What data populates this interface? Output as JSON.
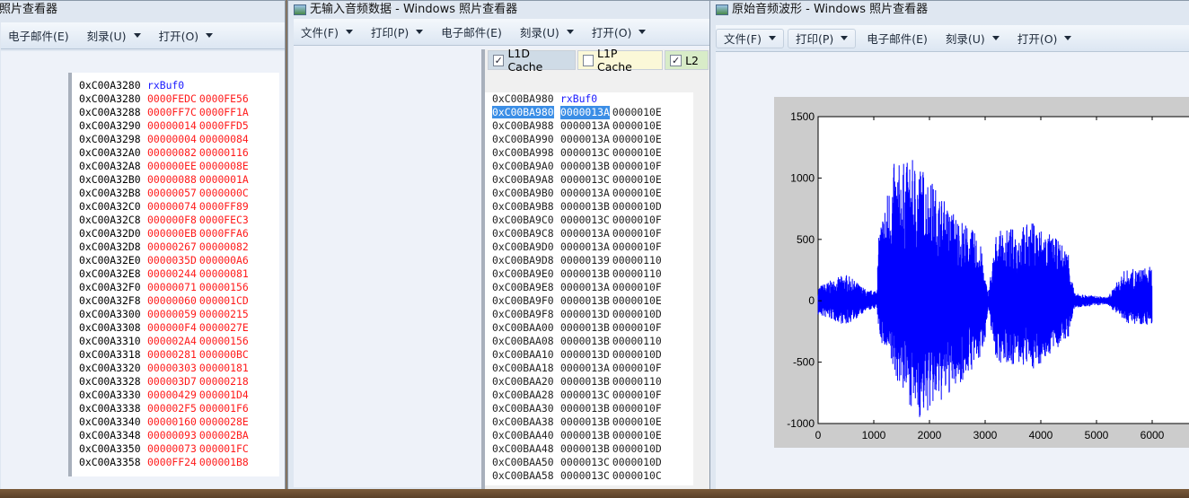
{
  "left_window": {
    "title": "照片查看器",
    "menus": [
      {
        "label": "电子邮件(E)",
        "caret": false
      },
      {
        "label": "刻录(U)",
        "caret": true
      },
      {
        "label": "打开(O)",
        "caret": true
      }
    ],
    "dump": {
      "header": [
        "0xC00A3280",
        "rxBuf0"
      ],
      "rows": [
        [
          "0xC00A3280",
          "0000FEDC",
          "0000FE56"
        ],
        [
          "0xC00A3288",
          "0000FF7C",
          "0000FF1A"
        ],
        [
          "0xC00A3290",
          "00000014",
          "0000FFD5"
        ],
        [
          "0xC00A3298",
          "00000004",
          "00000084"
        ],
        [
          "0xC00A32A0",
          "00000082",
          "00000116"
        ],
        [
          "0xC00A32A8",
          "000000EE",
          "0000008E"
        ],
        [
          "0xC00A32B0",
          "00000088",
          "0000001A"
        ],
        [
          "0xC00A32B8",
          "00000057",
          "0000000C"
        ],
        [
          "0xC00A32C0",
          "00000074",
          "0000FF89"
        ],
        [
          "0xC00A32C8",
          "000000F8",
          "0000FEC3"
        ],
        [
          "0xC00A32D0",
          "000000EB",
          "0000FFA6"
        ],
        [
          "0xC00A32D8",
          "00000267",
          "00000082"
        ],
        [
          "0xC00A32E0",
          "0000035D",
          "000000A6"
        ],
        [
          "0xC00A32E8",
          "00000244",
          "00000081"
        ],
        [
          "0xC00A32F0",
          "00000071",
          "00000156"
        ],
        [
          "0xC00A32F8",
          "00000060",
          "000001CD"
        ],
        [
          "0xC00A3300",
          "00000059",
          "00000215"
        ],
        [
          "0xC00A3308",
          "000000F4",
          "0000027E"
        ],
        [
          "0xC00A3310",
          "000002A4",
          "00000156"
        ],
        [
          "0xC00A3318",
          "00000281",
          "000000BC"
        ],
        [
          "0xC00A3320",
          "00000303",
          "00000181"
        ],
        [
          "0xC00A3328",
          "000003D7",
          "00000218"
        ],
        [
          "0xC00A3330",
          "00000429",
          "000001D4"
        ],
        [
          "0xC00A3338",
          "000002F5",
          "000001F6"
        ],
        [
          "0xC00A3340",
          "00000160",
          "0000028E"
        ],
        [
          "0xC00A3348",
          "00000093",
          "000002BA"
        ],
        [
          "0xC00A3350",
          "00000073",
          "000001FC"
        ],
        [
          "0xC00A3358",
          "0000FF24",
          "000001B8"
        ]
      ]
    }
  },
  "middle_window": {
    "title": "无输入音频数据 - Windows 照片查看器",
    "menus": [
      {
        "label": "文件(F)",
        "caret": true
      },
      {
        "label": "打印(P)",
        "caret": true
      },
      {
        "label": "电子邮件(E)",
        "caret": false
      },
      {
        "label": "刻录(U)",
        "caret": true
      },
      {
        "label": "打开(O)",
        "caret": true
      }
    ],
    "tabs": [
      {
        "label": "L1D Cache",
        "checked": true,
        "color": "#cfdbe6"
      },
      {
        "label": "L1P Cache",
        "checked": false,
        "color": "#fbf8d8"
      },
      {
        "label": "L2",
        "checked": true,
        "color": "#d8ecc8"
      }
    ],
    "dump": {
      "header": [
        "0xC00BA980",
        "rxBuf0"
      ],
      "rows": [
        [
          "0xC00BA980",
          "0000013A",
          "0000010E"
        ],
        [
          "0xC00BA988",
          "0000013A",
          "0000010E"
        ],
        [
          "0xC00BA990",
          "0000013A",
          "0000010E"
        ],
        [
          "0xC00BA998",
          "0000013C",
          "0000010E"
        ],
        [
          "0xC00BA9A0",
          "0000013B",
          "0000010F"
        ],
        [
          "0xC00BA9A8",
          "0000013C",
          "0000010E"
        ],
        [
          "0xC00BA9B0",
          "0000013A",
          "0000010E"
        ],
        [
          "0xC00BA9B8",
          "0000013B",
          "0000010D"
        ],
        [
          "0xC00BA9C0",
          "0000013C",
          "0000010F"
        ],
        [
          "0xC00BA9C8",
          "0000013A",
          "0000010F"
        ],
        [
          "0xC00BA9D0",
          "0000013A",
          "0000010F"
        ],
        [
          "0xC00BA9D8",
          "00000139",
          "00000110"
        ],
        [
          "0xC00BA9E0",
          "0000013B",
          "00000110"
        ],
        [
          "0xC00BA9E8",
          "0000013A",
          "0000010F"
        ],
        [
          "0xC00BA9F0",
          "0000013B",
          "0000010E"
        ],
        [
          "0xC00BA9F8",
          "0000013D",
          "0000010D"
        ],
        [
          "0xC00BAA00",
          "0000013B",
          "0000010F"
        ],
        [
          "0xC00BAA08",
          "0000013B",
          "00000110"
        ],
        [
          "0xC00BAA10",
          "0000013D",
          "0000010D"
        ],
        [
          "0xC00BAA18",
          "0000013A",
          "0000010F"
        ],
        [
          "0xC00BAA20",
          "0000013B",
          "00000110"
        ],
        [
          "0xC00BAA28",
          "0000013C",
          "0000010F"
        ],
        [
          "0xC00BAA30",
          "0000013B",
          "0000010F"
        ],
        [
          "0xC00BAA38",
          "0000013B",
          "0000010E"
        ],
        [
          "0xC00BAA40",
          "0000013B",
          "0000010E"
        ],
        [
          "0xC00BAA48",
          "0000013B",
          "0000010D"
        ],
        [
          "0xC00BAA50",
          "0000013C",
          "0000010D"
        ],
        [
          "0xC00BAA58",
          "0000013C",
          "0000010C"
        ]
      ]
    }
  },
  "right_window": {
    "title": "原始音频波形 - Windows 照片查看器",
    "menus": [
      {
        "label": "文件(F)",
        "caret": true,
        "boxed": true
      },
      {
        "label": "打印(P)",
        "caret": true,
        "boxed": true
      },
      {
        "label": "电子邮件(E)",
        "caret": false
      },
      {
        "label": "刻录(U)",
        "caret": true
      },
      {
        "label": "打开(O)",
        "caret": true
      }
    ]
  },
  "chart_data": {
    "type": "line",
    "title": "",
    "xlabel": "",
    "ylabel": "",
    "xlim": [
      0,
      7000
    ],
    "ylim": [
      -1000,
      1500
    ],
    "xticks": [
      0,
      1000,
      2000,
      3000,
      4000,
      5000,
      6000
    ],
    "yticks": [
      1500,
      1000,
      500,
      0,
      -500,
      -1000
    ],
    "line_color": "#0000ff",
    "samples": 6000,
    "envelope": [
      {
        "x": 0,
        "max": 120,
        "min": -120
      },
      {
        "x": 500,
        "max": 220,
        "min": -200
      },
      {
        "x": 900,
        "max": 80,
        "min": -80
      },
      {
        "x": 1050,
        "max": 100,
        "min": -60
      },
      {
        "x": 1100,
        "max": 620,
        "min": -300
      },
      {
        "x": 1350,
        "max": 1120,
        "min": -600
      },
      {
        "x": 1800,
        "max": 1160,
        "min": -980
      },
      {
        "x": 2300,
        "max": 800,
        "min": -800
      },
      {
        "x": 2900,
        "max": 520,
        "min": -500
      },
      {
        "x": 3000,
        "max": 200,
        "min": -300
      },
      {
        "x": 3050,
        "max": 60,
        "min": -80
      },
      {
        "x": 3200,
        "max": 560,
        "min": -500
      },
      {
        "x": 3900,
        "max": 650,
        "min": -560
      },
      {
        "x": 4500,
        "max": 420,
        "min": -300
      },
      {
        "x": 4600,
        "max": 60,
        "min": -60
      },
      {
        "x": 5200,
        "max": 30,
        "min": -30
      },
      {
        "x": 5500,
        "max": 250,
        "min": -180
      },
      {
        "x": 6000,
        "max": 280,
        "min": -200
      }
    ]
  }
}
